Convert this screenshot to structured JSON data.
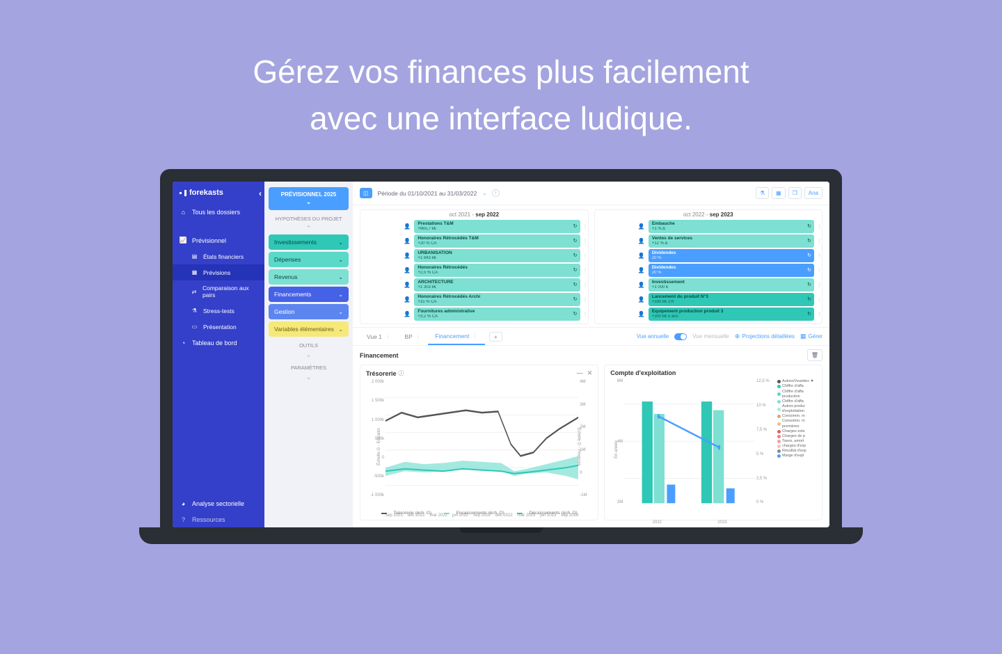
{
  "hero": {
    "line1": "Gérez vos finances plus facilement",
    "line2": "avec une interface ludique."
  },
  "sidebar": {
    "logo": "forekasts",
    "items": {
      "all_folders": "Tous les dossiers",
      "previsionnel": "Prévisionnel",
      "etats": "États financiers",
      "previsions": "Prévisions",
      "comparaison": "Comparaison aux pairs",
      "stress": "Stress-tests",
      "presentation": "Présentation",
      "tableau": "Tableau de bord",
      "analyse": "Analyse sectorielle",
      "ressources": "Ressources"
    }
  },
  "col2": {
    "head": "PRÉVISIONNEL 2025",
    "hyp": "HYPOTHÈSES DU PROJET",
    "cats": {
      "invest": "Investissements",
      "depenses": "Dépenses",
      "revenus": "Revenus",
      "financements": "Financements",
      "gestion": "Gestion",
      "variables": "Variables élémentaires"
    },
    "outils": "OUTILS",
    "param": "PARAMÈTRES"
  },
  "topbar": {
    "period": "Période du 01/10/2021 au 31/03/2022",
    "btn_ana": "Ana"
  },
  "periods": {
    "left": {
      "pre": "oct 2021 - ",
      "bold": "sep 2022"
    },
    "right": {
      "pre": "oct 2022 - ",
      "bold": "sep 2023"
    }
  },
  "cards_left": [
    {
      "title": "Prestations T&M",
      "sub": "+665,7 k€"
    },
    {
      "title": "Honoraires Rétrocédés T&M",
      "sub": "+20 % CA"
    },
    {
      "title": "URBANISATION",
      "sub": "+1 843 k€"
    },
    {
      "title": "Honoraires Rétrocédés",
      "sub": "+2,5 % CA"
    },
    {
      "title": "ARCHITECTURE",
      "sub": "+1 303 k€"
    },
    {
      "title": "Honoraires Rétrocédés Archi",
      "sub": "+15 % CA"
    },
    {
      "title": "Fournitures administrative",
      "sub": "+3,2 % CA"
    }
  ],
  "cards_right": [
    {
      "title": "Embauche",
      "sub": "+1 % Δ",
      "style": "light"
    },
    {
      "title": "Ventes de services",
      "sub": "+12 % Δ",
      "style": "light"
    },
    {
      "title": "Dividendes",
      "sub": "20 %",
      "style": "blue"
    },
    {
      "title": "Dividendes",
      "sub": "20 %",
      "style": "blue"
    },
    {
      "title": "Investissement",
      "sub": "+1 000 €",
      "style": "light"
    },
    {
      "title": "Lancement du produit N°3",
      "sub": "+330 k€          1%",
      "style": "dark"
    },
    {
      "title": "Equipement production produit 3",
      "sub": "+300 k€          5 ans",
      "style": "dark"
    }
  ],
  "tabs": {
    "vue1": "Vue 1",
    "bp": "BP",
    "fin": "Financement"
  },
  "tabs_right": {
    "annuelle": "Vue annuelle",
    "mensuelle": "Vue mensuelle",
    "projections": "Projections détaillées",
    "gerer": "Gérer"
  },
  "section": "Financement",
  "chart1": {
    "title": "Trésorerie",
    "ylabels": [
      "2 000k",
      "1 500k",
      "1 000k",
      "500k",
      "0",
      "-500k",
      "-1 000k"
    ],
    "yr_labels": [
      "4M",
      "3M",
      "2M",
      "1M",
      "0",
      "-1M"
    ],
    "ylabel_left": "Échelle G - Entrants",
    "ylabel_right": "Échelle D - Finances",
    "xlabels": [
      "sep 2021",
      "déc 2021",
      "mar 2022",
      "jun 2022",
      "sep 2022",
      "déc 2022",
      "mar 2023",
      "jun 2023",
      "sep 2023"
    ],
    "legend": {
      "a": "Trésorerie (éch. G)",
      "b": "Encaissements (éch. D)",
      "c": "Décaissements (éch. D)"
    }
  },
  "chart2": {
    "title": "Compte d'exploitation",
    "ylabels": [
      "6M",
      "4M",
      "2M"
    ],
    "yr_labels": [
      "12,5 %",
      "10 %",
      "7,5 %",
      "5 %",
      "2,5 %",
      "0 %"
    ],
    "ylabel_left": "En année",
    "xlabels": [
      "2022",
      "2023"
    ],
    "legend_items": [
      {
        "c": "#555",
        "t": "Autres/Vouettes ▼"
      },
      {
        "c": "#2fc7b5",
        "t": "Chiffre d'affa"
      },
      {
        "c": "#5ad8c8",
        "t": "Chiffre d'affa production"
      },
      {
        "c": "#7de0d2",
        "t": "Chiffre d'affa"
      },
      {
        "c": "#a8ebe0",
        "t": "Autres produi d'exploitation"
      },
      {
        "c": "#d9a86b",
        "t": "Consomm. m"
      },
      {
        "c": "#e8c090",
        "t": "Consomm. m premières"
      },
      {
        "c": "#e85a5a",
        "t": "Charges exte"
      },
      {
        "c": "#f08080",
        "t": "Charges de p"
      },
      {
        "c": "#f5a0a0",
        "t": "Taxes, amort"
      },
      {
        "c": "#fac0c0",
        "t": "charges d'exp"
      },
      {
        "c": "#888",
        "t": "Résultat d'exp"
      },
      {
        "c": "#4a9eff",
        "t": "Marge d'expl"
      }
    ]
  },
  "chart_data": [
    {
      "type": "line",
      "title": "Trésorerie",
      "x": [
        "sep 2021",
        "déc 2021",
        "mar 2022",
        "jun 2022",
        "sep 2022",
        "déc 2022",
        "mar 2023",
        "jun 2023",
        "sep 2023"
      ],
      "series": [
        {
          "name": "Trésorerie (éch. G)",
          "axis": "left",
          "values": [
            1200,
            1400,
            1300,
            1350,
            1400,
            1450,
            1400,
            500,
            400,
            900,
            1300
          ]
        },
        {
          "name": "Encaissements (éch. D)",
          "axis": "right",
          "values": [
            400,
            500,
            450,
            420,
            480,
            460,
            440,
            300,
            350,
            600,
            700
          ]
        },
        {
          "name": "Décaissements (éch. D)",
          "axis": "right",
          "values": [
            350,
            400,
            420,
            400,
            430,
            420,
            410,
            380,
            400,
            450,
            500
          ]
        }
      ],
      "ylim_left": [
        -1000,
        2000
      ],
      "ylim_right": [
        -1000000,
        4000000
      ],
      "xlabel": "",
      "ylabel_left": "Échelle G - Entrants (k€)",
      "ylabel_right": "Échelle D - Finances"
    },
    {
      "type": "bar",
      "title": "Compte d'exploitation",
      "categories": [
        "2022",
        "2023"
      ],
      "series": [
        {
          "name": "Chiffre d'affaires",
          "values": [
            6000000,
            6000000
          ],
          "color": "#2fc7b5"
        },
        {
          "name": "Charges",
          "values": [
            5200000,
            5400000
          ],
          "color": "#7de0d2"
        },
        {
          "name": "Résultat d'exploitation",
          "values": [
            800000,
            600000
          ],
          "color": "#4a9eff"
        }
      ],
      "line_series": {
        "name": "Marge d'exploitation (%)",
        "values": [
          11,
          8
        ],
        "axis": "right",
        "color": "#4a9eff"
      },
      "ylim_left": [
        0,
        6500000
      ],
      "ylim_right": [
        0,
        12.5
      ],
      "ylabel_left": "En année",
      "ylabel_right": "%"
    }
  ]
}
